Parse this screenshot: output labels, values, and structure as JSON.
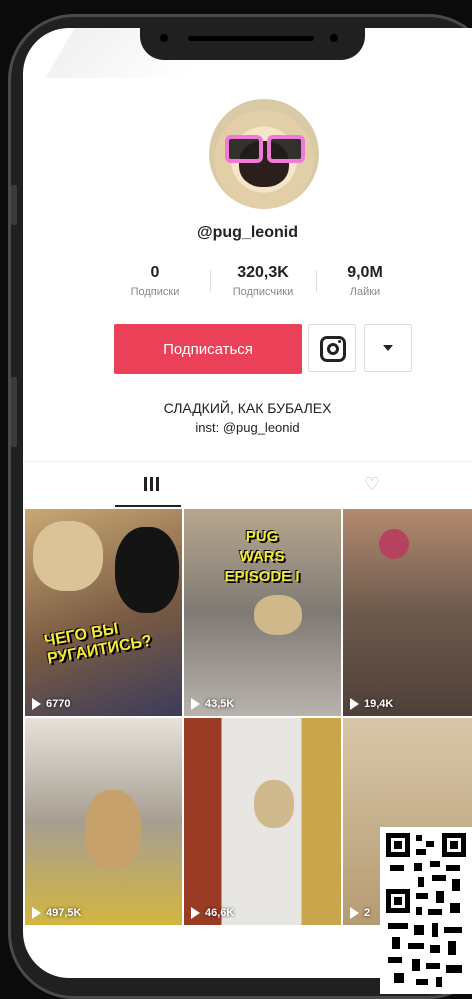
{
  "profile": {
    "username": "@pug_leonid",
    "avatar_icon": "pug-with-pink-glasses"
  },
  "stats": [
    {
      "value": "0",
      "label": "Подписки"
    },
    {
      "value": "320,3K",
      "label": "Подписчики"
    },
    {
      "value": "9,0M",
      "label": "Лайки"
    }
  ],
  "actions": {
    "follow_label": "Подписаться",
    "instagram_icon": "instagram-icon",
    "more_icon": "caret-down-icon"
  },
  "bio": {
    "line1": "СЛАДКИЙ, КАК БУБАЛЕХ",
    "line2": "inst: @pug_leonid"
  },
  "tabs": [
    {
      "icon": "grid-icon",
      "active": true
    },
    {
      "icon": "liked-heart-icon",
      "active": false
    }
  ],
  "videos": [
    {
      "views": "6770",
      "caption": "ЧЕГО ВЫ РУГАИТИСЬ?"
    },
    {
      "views": "43,5K",
      "caption": "PUG WARS EPISODE I"
    },
    {
      "views": "19,4K",
      "caption": ""
    },
    {
      "views": "497,5K",
      "caption": ""
    },
    {
      "views": "46,6K",
      "caption": ""
    },
    {
      "views": "2",
      "caption": ""
    }
  ],
  "colors": {
    "accent": "#ea4159",
    "caption_yellow": "#f4ec3a"
  }
}
